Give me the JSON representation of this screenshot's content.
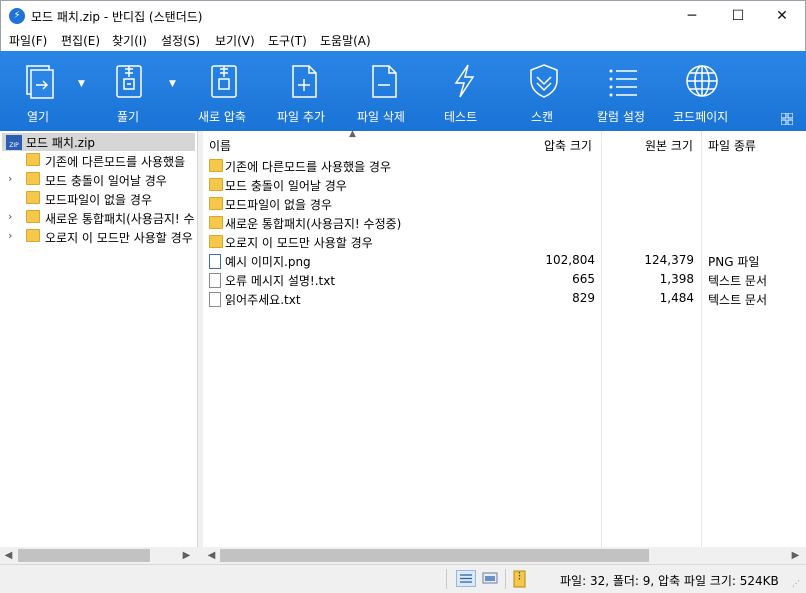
{
  "window": {
    "title": "모드 패치.zip - 반디집 (스탠더드)",
    "minimize_glyph": "─",
    "maximize_glyph": "☐",
    "close_glyph": "✕"
  },
  "menu": [
    "파일(F)",
    "편집(E)",
    "찾기(I)",
    "설정(S)",
    "보기(V)",
    "도구(T)",
    "도움말(A)"
  ],
  "toolbar": {
    "color": "#2a86e6",
    "buttons": [
      {
        "label": "열기",
        "icon": "open-icon"
      },
      {
        "label": "풀기",
        "icon": "extract-icon"
      },
      {
        "label": "새로 압축",
        "icon": "new-archive-icon"
      },
      {
        "label": "파일 추가",
        "icon": "add-file-icon"
      },
      {
        "label": "파일 삭제",
        "icon": "delete-file-icon"
      },
      {
        "label": "테스트",
        "icon": "test-icon"
      },
      {
        "label": "스캔",
        "icon": "scan-shield-icon"
      },
      {
        "label": "칼럼 설정",
        "icon": "column-settings-icon"
      },
      {
        "label": "코드페이지",
        "icon": "codepage-globe-icon"
      }
    ]
  },
  "tree": {
    "root": "모드 패치.zip",
    "items": [
      {
        "label": "기존에 다른모드를 사용했을",
        "expandable": false
      },
      {
        "label": "모드 충돌이 일어날 경우",
        "expandable": true
      },
      {
        "label": "모드파일이 없을 경우",
        "expandable": false
      },
      {
        "label": "새로운 통합패치(사용금지! 수",
        "expandable": true
      },
      {
        "label": "오로지 이 모드만 사용할 경우",
        "expandable": true
      }
    ]
  },
  "list": {
    "columns": {
      "name": "이름",
      "packed": "압축 크기",
      "original": "원본 크기",
      "type": "파일 종류"
    },
    "rows": [
      {
        "name": "기존에 다른모드를 사용했을 경우",
        "kind": "folder",
        "packed": "",
        "original": "",
        "type": ""
      },
      {
        "name": "모드 충돌이 일어날 경우",
        "kind": "folder",
        "packed": "",
        "original": "",
        "type": ""
      },
      {
        "name": "모드파일이 없을 경우",
        "kind": "folder",
        "packed": "",
        "original": "",
        "type": ""
      },
      {
        "name": "새로운 통합패치(사용금지! 수정중)",
        "kind": "folder",
        "packed": "",
        "original": "",
        "type": ""
      },
      {
        "name": "오로지 이 모드만 사용할 경우",
        "kind": "folder",
        "packed": "",
        "original": "",
        "type": ""
      },
      {
        "name": "예시 이미지.png",
        "kind": "image",
        "packed": "102,804",
        "original": "124,379",
        "type": "PNG 파일"
      },
      {
        "name": "오류 메시지 설명!.txt",
        "kind": "text",
        "packed": "665",
        "original": "1,398",
        "type": "텍스트 문서"
      },
      {
        "name": "읽어주세요.txt",
        "kind": "text",
        "packed": "829",
        "original": "1,484",
        "type": "텍스트 문서"
      }
    ]
  },
  "status": {
    "text": "파일: 32, 폴더: 9, 압축 파일 크기: 524KB"
  }
}
